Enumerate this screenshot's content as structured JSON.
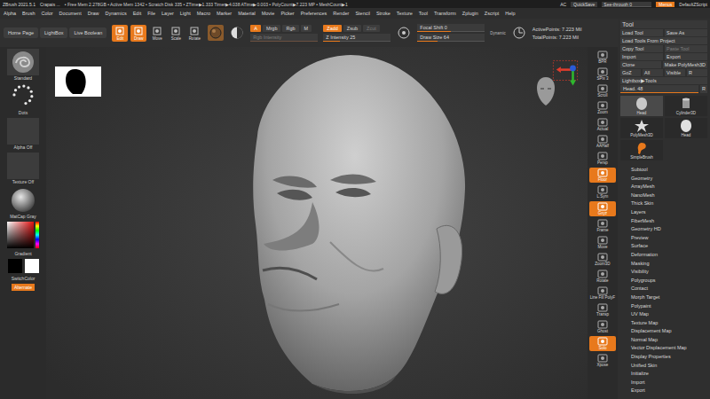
{
  "title_bar": {
    "app": "ZBrush 2021.5.1",
    "document": "Crapais ...",
    "stats": "• Free Mem 2.278GB • Active Mem 1342 • Scratch Disk 335 • ZTime▶1.333 Timer▶4.038 ATime▶0.003 • PolyCount▶7.223 MP • MeshCount▶1",
    "ac": "AC",
    "quicksave": "QuickSave",
    "see_through": {
      "label": "See-through 0",
      "level": 0
    },
    "menus": {
      "label": "Menus",
      "selected": true
    },
    "script": "DefaultZScript"
  },
  "menu_bar": [
    "Alpha",
    "Brush",
    "Color",
    "Document",
    "Draw",
    "Dynamics",
    "Edit",
    "File",
    "Layer",
    "Light",
    "Macro",
    "Marker",
    "Material",
    "Movie",
    "Picker",
    "Preferences",
    "Render",
    "Stencil",
    "Stroke",
    "Texture",
    "Tool",
    "Transform",
    "Zplugin",
    "Zscript",
    "Help"
  ],
  "toolbar": {
    "home": [
      "Home Page",
      "LightBox",
      "Live Boolean"
    ],
    "modes": [
      {
        "label": "Edit",
        "selected": true
      },
      {
        "label": "Draw",
        "selected": true
      },
      {
        "label": "Move",
        "selected": false
      },
      {
        "label": "Scale",
        "selected": false
      },
      {
        "label": "Rotate",
        "selected": false
      }
    ],
    "channels": [
      {
        "label": "A",
        "selected": true
      },
      {
        "label": "Mrgb",
        "selected": false
      },
      {
        "label": "Rgb",
        "selected": false
      },
      {
        "label": "M",
        "selected": false
      }
    ],
    "rgb_intensity": {
      "label": "Rgb Intensity",
      "level": 1,
      "disabled": true
    },
    "z_modes": [
      {
        "label": "Zadd",
        "selected": true,
        "disabled": false
      },
      {
        "label": "Zsub",
        "selected": false,
        "disabled": false
      },
      {
        "label": "Zcut",
        "selected": false,
        "disabled": true
      }
    ],
    "z_intensity": {
      "label": "Z Intensity 25",
      "level": 0.25,
      "disabled": false
    },
    "sliders": [
      {
        "label": "Focal Shift 0",
        "level": 0.5
      },
      {
        "label": "Draw Size 64",
        "level": 0.3
      }
    ],
    "dynamic": "Dynamic",
    "points": [
      "ActivePoints: 7.223 Mil",
      "TotalPoints: 7.223 Mil"
    ]
  },
  "left_shelf": {
    "items": [
      {
        "label": "Standard",
        "kind": "brush"
      },
      {
        "label": "Dots",
        "kind": "stroke"
      },
      {
        "label": "Alpha Off",
        "kind": "empty"
      },
      {
        "label": "Texture Off",
        "kind": "empty"
      },
      {
        "label": "MatCap Gray",
        "kind": "material"
      }
    ],
    "gradient": "Gradient",
    "main_color": "#000000",
    "secondary_color": "#ffffff",
    "switch": "SwitchColor",
    "alternate": {
      "label": "Alternate",
      "selected": true
    }
  },
  "right_shelf": [
    {
      "label": "BPR",
      "selected": false
    },
    {
      "label": "SPix 3",
      "selected": false
    },
    {
      "label": "Scroll",
      "selected": false
    },
    {
      "label": "Zoom",
      "selected": false
    },
    {
      "label": "Actual",
      "selected": false
    },
    {
      "label": "AAHalf",
      "selected": false
    },
    {
      "label": "Persp",
      "selected": false
    },
    {
      "label": "Floor",
      "selected": true
    },
    {
      "label": "L.Sym",
      "selected": false
    },
    {
      "label": "Gxyz",
      "selected": true
    },
    {
      "label": "Frame",
      "selected": false
    },
    {
      "label": "Move",
      "selected": false
    },
    {
      "label": "Zoom3D",
      "selected": false
    },
    {
      "label": "Rotate",
      "selected": false
    },
    {
      "label": "Line Fill PolyF",
      "selected": false
    },
    {
      "label": "Transp",
      "selected": false
    },
    {
      "label": "Ghost",
      "selected": false
    },
    {
      "label": "Solo",
      "selected": true
    },
    {
      "label": "Xpose",
      "selected": false
    }
  ],
  "tool_panel": {
    "title": "Tool",
    "button_rows": [
      [
        {
          "label": "Load Tool",
          "disabled": false
        },
        {
          "label": "Save As",
          "disabled": false
        }
      ],
      [
        {
          "label": "Load Tools From Project",
          "disabled": false
        }
      ],
      [
        {
          "label": "Copy Tool",
          "disabled": false
        },
        {
          "label": "Paste Tool",
          "disabled": true
        }
      ],
      [
        {
          "label": "Import",
          "disabled": false
        },
        {
          "label": "Export",
          "disabled": false
        }
      ],
      [
        {
          "label": "Clone",
          "disabled": false
        },
        {
          "label": "Make PolyMesh3D",
          "disabled": false
        }
      ],
      [
        {
          "label": "GoZ",
          "disabled": false
        },
        {
          "label": "All",
          "disabled": false
        },
        {
          "label": "Visible",
          "disabled": false
        },
        {
          "label": "R",
          "disabled": false
        }
      ]
    ],
    "lightbox": "Lightbox▶Tools",
    "head_slider": {
      "label": "Head. 48",
      "level": 1
    },
    "r": "R",
    "thumbnails": [
      {
        "label": "Head",
        "kind": "head",
        "selected": true
      },
      {
        "label": "Cylinder3D",
        "kind": "cylinder",
        "selected": false
      },
      {
        "label": "PolyMesh3D",
        "kind": "star",
        "selected": false
      },
      {
        "label": "Head",
        "kind": "small-head",
        "selected": false
      },
      {
        "label": "SimpleBrush",
        "kind": "brush",
        "selected": false
      }
    ],
    "sections": [
      "Subtool",
      "Geometry",
      "ArrayMesh",
      "NanoMesh",
      "Thick Skin",
      "Layers",
      "FiberMesh",
      "Geometry HD",
      "Preview",
      "Surface",
      "Deformation",
      "Masking",
      "Visibility",
      "Polygroups",
      "Contact",
      "Morph Target",
      "Polypaint",
      "UV Map",
      "Texture Map",
      "Displacement Map",
      "Normal Map",
      "Vector Displacement Map",
      "Display Properties",
      "Unified Skin",
      "Initialize",
      "Import",
      "Export"
    ]
  }
}
